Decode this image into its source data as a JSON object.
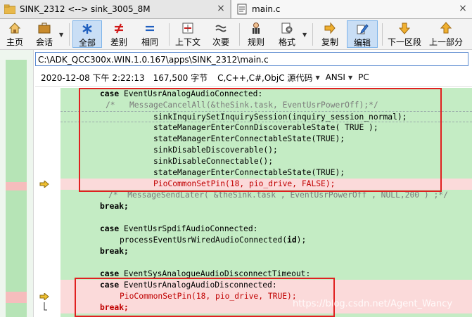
{
  "tabs": [
    {
      "title": "SINK_2312 <--> sink_3005_8M",
      "close": "×"
    },
    {
      "title": "main.c",
      "close": "×"
    }
  ],
  "toolbar": {
    "home": "主页",
    "session": "会话",
    "all": "全部",
    "diffs": "差别",
    "same": "相同",
    "context": "上下文",
    "minor": "次要",
    "rules": "规则",
    "format": "格式",
    "copy": "复制",
    "edit": "编辑",
    "next_section": "下一区段",
    "prev_section": "上一部分"
  },
  "path": "C:\\ADK_QCC300x.WIN.1.0.167\\apps\\SINK_2312\\main.c",
  "info": {
    "datetime": "2020-12-08 下午 2:22:13",
    "size": "167,500 字节",
    "language": "C,C++,C#,ObjC 源代码",
    "encoding": "ANSI",
    "line_ending": "PC"
  },
  "code": {
    "l1_kw": "case",
    "l1_rest": " EventUsrAnalogAudioConnected:",
    "l2": "/*   MessageCancelAll(&theSink.task, EventUsrPowerOff);*/",
    "l3": "sinkInquirySetInquirySession(inquiry_session_normal);",
    "l4": "stateManagerEnterConnDiscoverableState( TRUE );",
    "l5": "stateManagerEnterConnectableState(TRUE);",
    "l6": "sinkDisableDiscoverable();",
    "l7": "sinkDisableConnectable();",
    "l8": "stateManagerEnterConnectableState(TRUE);",
    "l9": "PioCommonSetPin(18, pio_drive, FALSE);",
    "l10": "/*  MessageSendLater( &theSink.task , EventUsrPowerOff , NULL,200 ) ;*/",
    "l11": "break;",
    "l13_kw": "case",
    "l13_rest": " EventUsrSpdifAudioConnected:",
    "l14": "processEventUsrWiredAudioConnected(",
    "l14_id": "id",
    "l14_end": ");",
    "l15": "break;",
    "l17_kw": "case",
    "l17_rest": " EventSysAnalogueAudioDisconnectTimeout:",
    "l18_kw": "case",
    "l18_rest": " EventUsrAnalogAudioDisconnected:",
    "l19": "PioCommonSetPin(18, pio_drive, TRUE);",
    "l20": "break;"
  },
  "watermark": "https://blog.csdn.net/Agent_Wancy",
  "colors": {
    "same_bg": "#c4ecc4",
    "diff_bg": "#fbdada",
    "highlight_box": "#e02020",
    "diff_text": "#c00000"
  }
}
